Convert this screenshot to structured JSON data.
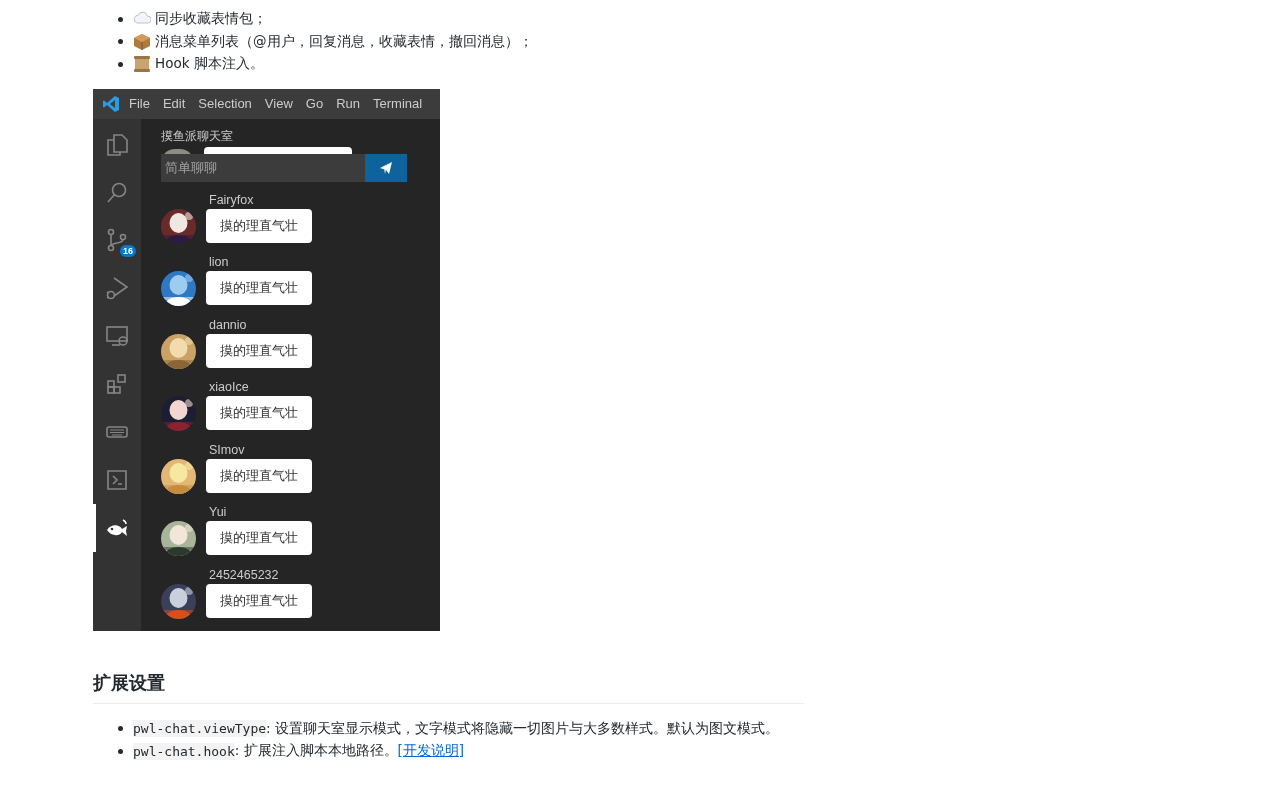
{
  "features": [
    {
      "kind": "cloud",
      "text": "同步收藏表情包；"
    },
    {
      "kind": "package",
      "text": "消息菜单列表（@用户，回复消息，收藏表情，撤回消息）；"
    },
    {
      "kind": "scroll",
      "text": "Hook 脚本注入。"
    }
  ],
  "screenshot": {
    "menu": [
      "File",
      "Edit",
      "Selection",
      "View",
      "Go",
      "Run",
      "Terminal"
    ],
    "activity_bar": [
      {
        "kind": "files",
        "selected": false
      },
      {
        "kind": "search",
        "selected": false
      },
      {
        "kind": "source-control",
        "selected": false,
        "badge": "16"
      },
      {
        "kind": "run",
        "selected": false
      },
      {
        "kind": "remote",
        "selected": false
      },
      {
        "kind": "extensions",
        "selected": false
      },
      {
        "kind": "keyboard",
        "selected": false
      },
      {
        "kind": "terminal",
        "selected": false
      },
      {
        "kind": "fish",
        "selected": true
      }
    ],
    "chat": {
      "title": "摸鱼派聊天室",
      "input": {
        "placeholder": "简单聊聊"
      },
      "messages": [
        {
          "user": "Fairyfox",
          "text": "摸的理直气壮"
        },
        {
          "user": "lion",
          "text": "摸的理直气壮"
        },
        {
          "user": "dannio",
          "text": "摸的理直气壮"
        },
        {
          "user": "xiaoIce",
          "text": "摸的理直气壮"
        },
        {
          "user": "SImov",
          "text": "摸的理直气壮"
        },
        {
          "user": "Yui",
          "text": "摸的理直气壮"
        },
        {
          "user": "2452465232",
          "text": "摸的理直气壮"
        }
      ]
    }
  },
  "settings": {
    "heading": "扩展设置",
    "items": [
      {
        "key": "pwl-chat.viewType",
        "text": ": 设置聊天室显示模式，文字模式将隐藏一切图片与大多数样式。默认为图文模式。"
      },
      {
        "key": "pwl-chat.hook",
        "text": ": 扩展注入脚本本地路径。",
        "link": "[开发说明]"
      }
    ]
  }
}
